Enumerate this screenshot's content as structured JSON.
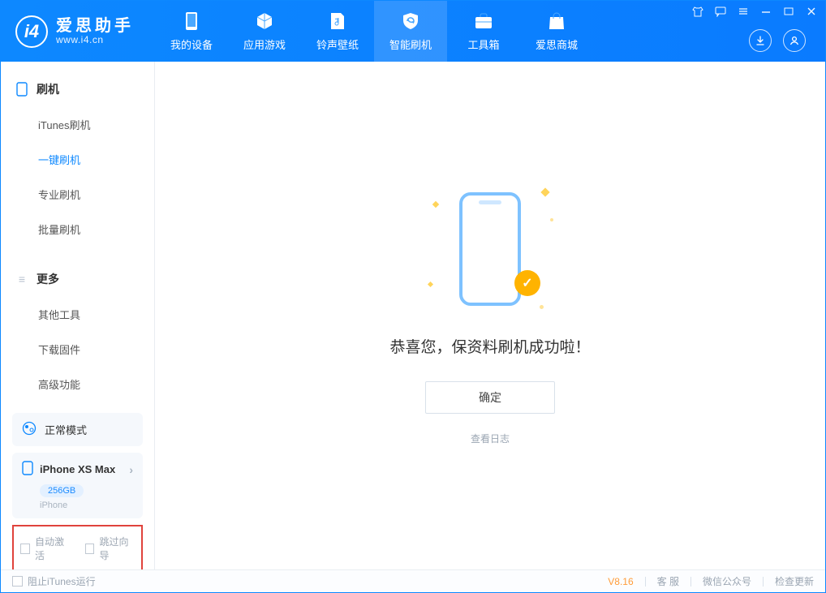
{
  "app": {
    "title": "爱思助手",
    "sub": "www.i4.cn"
  },
  "nav": {
    "device": "我的设备",
    "apps": "应用游戏",
    "ring": "铃声壁纸",
    "flash": "智能刷机",
    "tools": "工具箱",
    "store": "爱思商城"
  },
  "sidebar": {
    "section1": {
      "title": "刷机",
      "items": [
        "iTunes刷机",
        "一键刷机",
        "专业刷机",
        "批量刷机"
      ],
      "activeIndex": 1
    },
    "section2": {
      "title": "更多",
      "items": [
        "其他工具",
        "下载固件",
        "高级功能"
      ]
    },
    "mode": "正常模式",
    "device": {
      "name": "iPhone XS Max",
      "storage": "256GB",
      "type": "iPhone"
    },
    "opts": {
      "auto_activate": "自动激活",
      "skip_guide": "跳过向导"
    }
  },
  "main": {
    "result": "恭喜您，保资料刷机成功啦！",
    "ok": "确定",
    "view_log": "查看日志"
  },
  "footer": {
    "block_itunes": "阻止iTunes运行",
    "version": "V8.16",
    "service": "客 服",
    "wechat": "微信公众号",
    "update": "检查更新"
  }
}
